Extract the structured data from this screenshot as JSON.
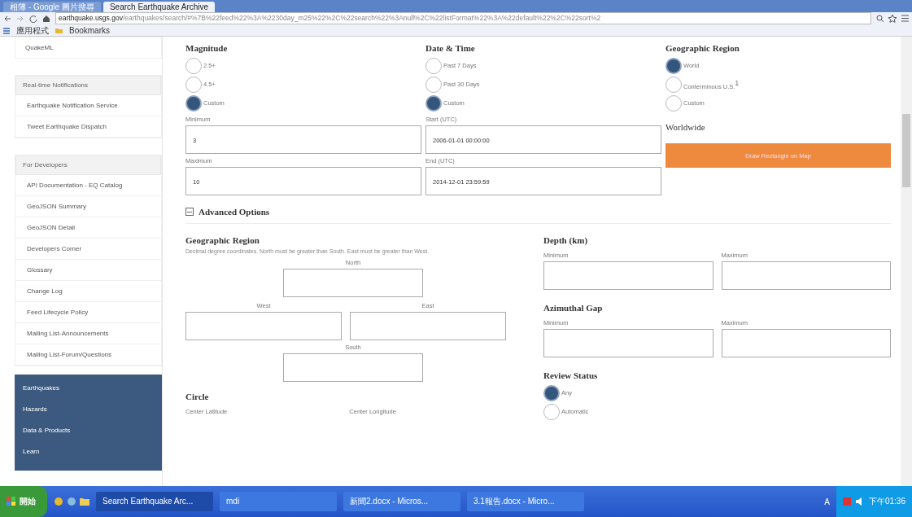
{
  "browser": {
    "tabs": [
      {
        "title": "相簿 - Google 圖片搜尋",
        "selected": false
      },
      {
        "title": "Search Earthquake Archive",
        "selected": true
      }
    ],
    "url_host": "earthquake.usgs.gov",
    "url_path": "/earthquakes/search/#%7B%22feed%22%3A%2230day_m25%22%2C%22search%22%3Anull%2C%22listFormat%22%3A%22default%22%2C%22sort%2",
    "bookmarks": [
      "應用程式",
      "Bookmarks"
    ]
  },
  "sidebar": {
    "top_link": "QuakeML",
    "groups": [
      {
        "header": "Real-time Notifications",
        "items": [
          "Earthquake Notification Service",
          "Tweet Earthquake Dispatch"
        ]
      },
      {
        "header": "For Developers",
        "items": [
          "API Documentation - EQ Catalog",
          "GeoJSON Summary",
          "GeoJSON Detail",
          "Developers Corner",
          "Glossary",
          "Change Log",
          "Feed Lifecycle Policy",
          "Mailing List-Announcements",
          "Mailing List-Forum/Questions"
        ]
      }
    ],
    "nav": [
      "Earthquakes",
      "Hazards",
      "Data & Products",
      "Learn"
    ]
  },
  "magnitude": {
    "title": "Magnitude",
    "options": [
      {
        "label": "2.5+",
        "selected": false
      },
      {
        "label": "4.5+",
        "selected": false
      },
      {
        "label": "Custom",
        "selected": true
      }
    ],
    "fields": [
      {
        "label": "Minimum",
        "value": "3"
      },
      {
        "label": "Maximum",
        "value": "10"
      }
    ]
  },
  "date_time": {
    "title": "Date & Time",
    "options": [
      {
        "label": "Past 7 Days",
        "selected": false
      },
      {
        "label": "Past 30 Days",
        "selected": false
      },
      {
        "label": "Custom",
        "selected": true
      }
    ],
    "fields": [
      {
        "label": "Start (UTC)",
        "value": "2006-01-01 00:00:00"
      },
      {
        "label": "End (UTC)",
        "value": "2014-12-01 23:59:59"
      }
    ]
  },
  "geographic_region": {
    "title": "Geographic Region",
    "options": [
      {
        "label": "World",
        "selected": true
      },
      {
        "label": "Conterminous U.S.$^{1}$",
        "selected": false
      },
      {
        "label": "Custom",
        "selected": false
      }
    ],
    "summary": "Worldwide",
    "button": "Draw Rectangle on Map"
  },
  "advanced": {
    "title": "Advanced Options",
    "expanded": true,
    "region": {
      "title": "Geographic Region",
      "hint": "Decimal degree coordinates. North must be greater than South. East must be greater than West.",
      "north": "North",
      "west": "West",
      "east": "East",
      "south": "South"
    },
    "circle": {
      "title": "Circle",
      "latitude": "Center Latitude",
      "longitude": "Center Longitude"
    },
    "depth": {
      "title": "Depth (km)",
      "min": "Minimum",
      "max": "Maximum"
    },
    "gap": {
      "title": "Azimuthal Gap",
      "min": "Minimum",
      "max": "Maximum"
    },
    "review": {
      "title": "Review Status",
      "options": [
        {
          "label": "Any",
          "selected": true
        },
        {
          "label": "Automatic",
          "selected": false
        }
      ]
    }
  },
  "taskbar": {
    "start": "開始",
    "windows": [
      {
        "title": "Search Earthquake Arc...",
        "selected": true
      },
      {
        "title": "mdi",
        "selected": false
      },
      {
        "title": "新聞2.docx - Micros...",
        "selected": false
      },
      {
        "title": "3.1報告.docx - Micro...",
        "selected": false
      }
    ],
    "tray": [
      "A"
    ],
    "clock": "下午01:36"
  }
}
